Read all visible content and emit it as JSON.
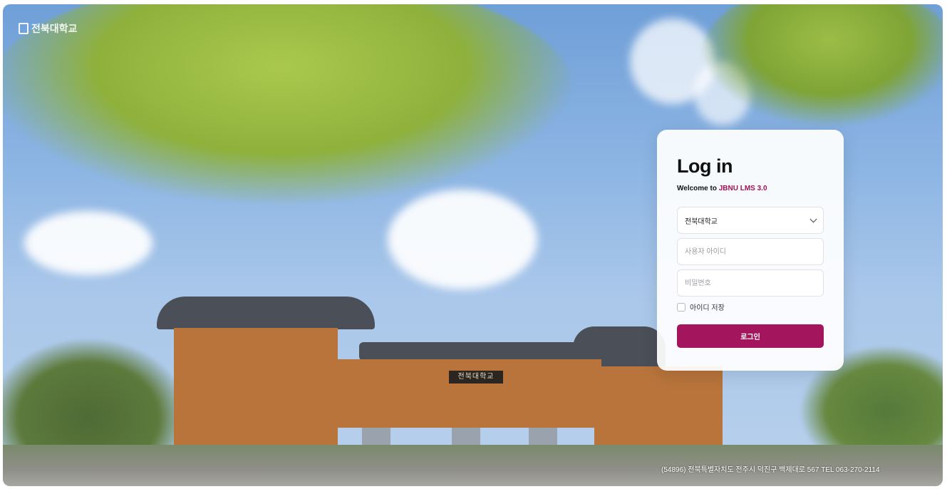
{
  "brand": {
    "logo_text": "전북대학교"
  },
  "scene": {
    "signboard_text": "전북대학교"
  },
  "login": {
    "title": "Log in",
    "welcome_prefix": "Welcome to ",
    "welcome_brand": "JBNU LMS 3.0",
    "university_select": {
      "selected": "전북대학교",
      "icon": "chevron-down-icon"
    },
    "user_id": {
      "placeholder": "사용자 아이디",
      "value": ""
    },
    "password": {
      "placeholder": "비밀번호",
      "value": ""
    },
    "remember_label": "아이디 저장",
    "remember_checked": false,
    "submit_label": "로그인"
  },
  "footer": {
    "address": "(54896) 전북특별자치도 전주시 덕진구 백제대로 567 TEL 063-270-2114"
  },
  "colors": {
    "accent": "#a3155c",
    "brand_text": "#a01058"
  }
}
